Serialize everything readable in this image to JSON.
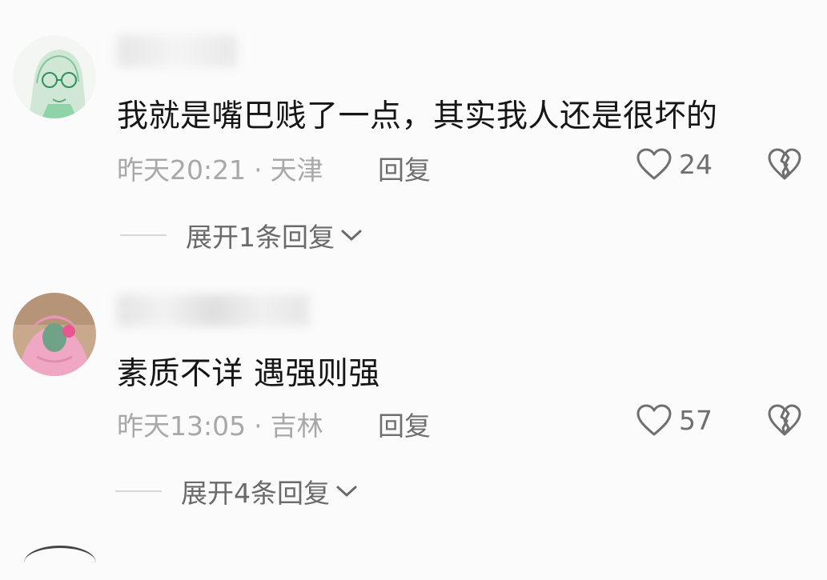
{
  "comments": [
    {
      "text": "我就是嘴巴贱了一点，其实我人还是很坏的",
      "time": "昨天20:21",
      "separator": "·",
      "location": "天津",
      "reply_label": "回复",
      "likes": "24",
      "expand_label": "展开1条回复",
      "avatar_icon": "anime-girl-glasses-avatar",
      "like_icon": "heart-outline-icon",
      "dislike_icon": "broken-heart-icon"
    },
    {
      "text": "素质不详 遇强则强",
      "time": "昨天13:05",
      "separator": "·",
      "location": "吉林",
      "reply_label": "回复",
      "likes": "57",
      "expand_label": "展开4条回复",
      "avatar_icon": "pink-hoodie-avatar",
      "like_icon": "heart-outline-icon",
      "dislike_icon": "broken-heart-icon"
    }
  ],
  "colors": {
    "background": "#fbfbfb",
    "text": "#161616",
    "meta": "#a8a8a8",
    "action": "#6f6f6f"
  }
}
